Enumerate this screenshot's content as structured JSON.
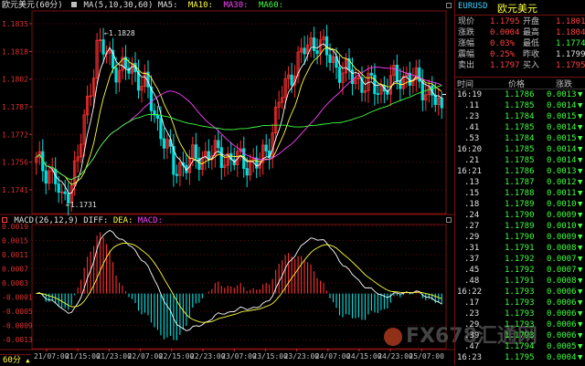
{
  "chart": {
    "title": "欧元美元(60分)",
    "ma_label": "MA(5,10,30,60)",
    "ma5_label": "MA5:",
    "ma10_label": "MA10:",
    "ma30_label": "MA30:",
    "ma60_label": "MA60:",
    "high_label": "1.1828",
    "low_label": "1.1731",
    "y_ticks": [
      "1.1835",
      "1.1818",
      "1.1802",
      "1.1787",
      "1.1772",
      "1.1756",
      "1.1741"
    ],
    "macd_label": "MACD(26,12,9)",
    "macd_diff": "DIFF:",
    "macd_dea": "DEA:",
    "macd_macd": "MACD:",
    "macd_ticks": [
      "0.0019",
      "0.0015",
      "0.0011",
      "0.0007",
      "0.0003",
      "-0.0001",
      "-0.0005",
      "-0.0009",
      "-0.0013"
    ],
    "x_ticks": [
      "21/07:00",
      "21/15:00",
      "21/23:00",
      "22/07:00",
      "22/15:00",
      "22/23:00",
      "23/07:00",
      "23/15:00",
      "23/23:00",
      "24/07:00",
      "24/15:00",
      "24/23:00",
      "25/07:00"
    ],
    "period": "60分",
    "colors": {
      "up": "#ff3030",
      "down": "#00e0e0",
      "ma5": "#ffffff",
      "ma10": "#ffff40",
      "ma30": "#ff40ff",
      "ma60": "#40ff40"
    }
  },
  "watermark": {
    "text": "FX678汇通网"
  },
  "panel": {
    "title_code": "EURUSD",
    "title_name": "欧元美元",
    "quotes": [
      {
        "l1": "现价",
        "v1": "1.1795",
        "c1": "red",
        "l2": "开盘",
        "v2": "1.1801",
        "c2": "red"
      },
      {
        "l1": "涨跌",
        "v1": "0.0004",
        "c1": "red",
        "l2": "最高",
        "v2": "1.1804",
        "c2": "red"
      },
      {
        "l1": "涨幅",
        "v1": "0.03%",
        "c1": "red",
        "l2": "最低",
        "v2": "1.1774",
        "c2": "grn"
      },
      {
        "l1": "震幅",
        "v1": "0.25%",
        "c1": "red",
        "l2": "昨收",
        "v2": "1.1799",
        "c2": "wht"
      },
      {
        "l1": "卖出",
        "v1": "1.1797",
        "c1": "red",
        "l2": "买入",
        "v2": "1.1795",
        "c2": "red"
      }
    ],
    "head": {
      "time": "时间",
      "price": "价格",
      "change": "涨跌"
    },
    "ticks": [
      {
        "t": "16:19",
        "p": "1.1786",
        "c": "0.0013"
      },
      {
        "t": ".11",
        "p": "1.1785",
        "c": "0.0014"
      },
      {
        "t": ".23",
        "p": "1.1784",
        "c": "0.0015"
      },
      {
        "t": ".41",
        "p": "1.1785",
        "c": "0.0014"
      },
      {
        "t": ".53",
        "p": "1.1784",
        "c": "0.0015"
      },
      {
        "t": "16:20",
        "p": "1.1785",
        "c": "0.0014"
      },
      {
        "t": ".21",
        "p": "1.1785",
        "c": "0.0014"
      },
      {
        "t": "16:21",
        "p": "1.1786",
        "c": "0.0013"
      },
      {
        "t": ".13",
        "p": "1.1787",
        "c": "0.0012"
      },
      {
        "t": ".15",
        "p": "1.1788",
        "c": "0.0011"
      },
      {
        "t": ".18",
        "p": "1.1789",
        "c": "0.0010"
      },
      {
        "t": ".24",
        "p": "1.1790",
        "c": "0.0009"
      },
      {
        "t": ".27",
        "p": "1.1789",
        "c": "0.0010"
      },
      {
        "t": ".29",
        "p": "1.1790",
        "c": "0.0009"
      },
      {
        "t": ".31",
        "p": "1.1791",
        "c": "0.0008"
      },
      {
        "t": ".37",
        "p": "1.1792",
        "c": "0.0007"
      },
      {
        "t": ".45",
        "p": "1.1792",
        "c": "0.0007"
      },
      {
        "t": ".48",
        "p": "1.1791",
        "c": "0.0008"
      },
      {
        "t": "16:22",
        "p": "1.1793",
        "c": "0.0006"
      },
      {
        "t": ".17",
        "p": "1.1793",
        "c": "0.0006"
      },
      {
        "t": ".23",
        "p": "1.1793",
        "c": "0.0006"
      },
      {
        "t": ".29",
        "p": "1.1793",
        "c": "0.0006"
      },
      {
        "t": ".39",
        "p": "1.1793",
        "c": "0.0006"
      },
      {
        "t": ".47",
        "p": "1.1794",
        "c": "0.0005"
      },
      {
        "t": "16:23",
        "p": "1.1795",
        "c": "0.0004"
      }
    ]
  }
}
